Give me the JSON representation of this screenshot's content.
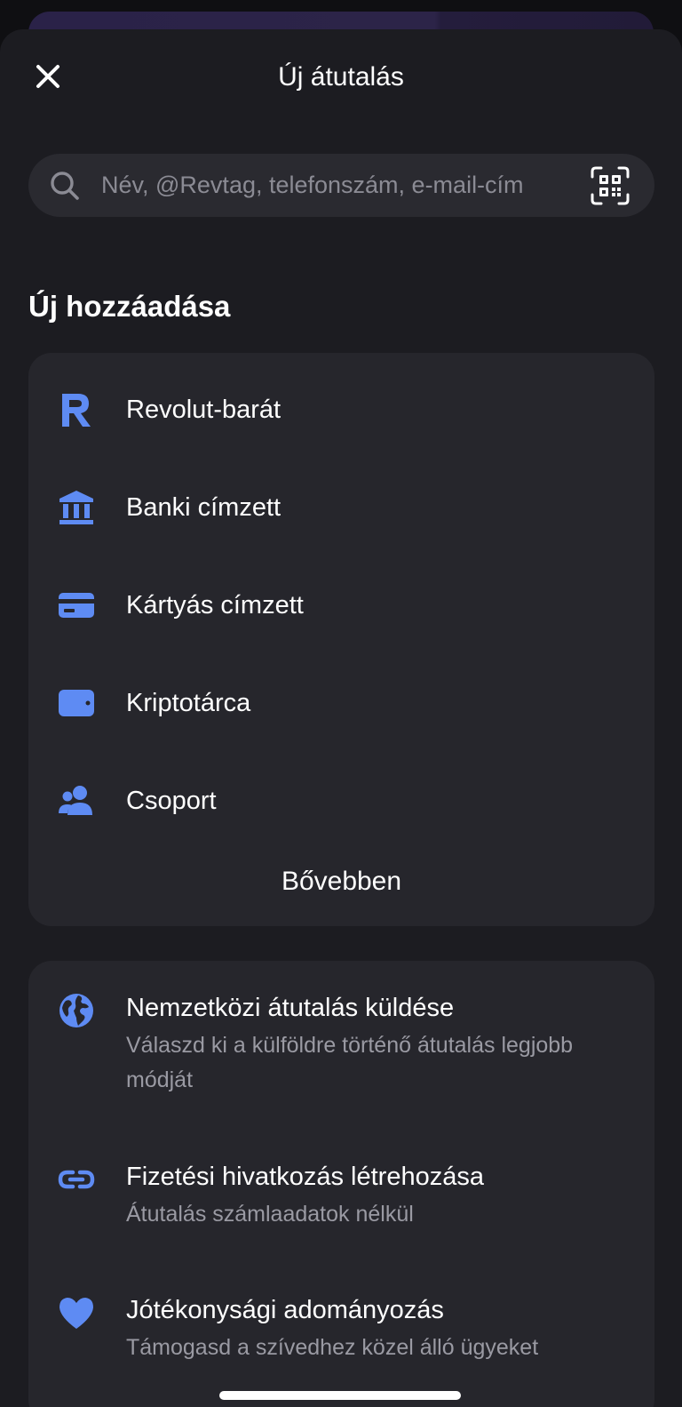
{
  "header": {
    "title": "Új átutalás",
    "close_icon": "close-icon"
  },
  "search": {
    "placeholder": "Név, @Revtag, telefonszám, e-mail-cím",
    "search_icon": "search-icon",
    "scan_icon": "qr-scan-icon"
  },
  "add_new": {
    "title": "Új hozzáadása",
    "items": [
      {
        "label": "Revolut-barát",
        "icon": "revolut-logo-icon"
      },
      {
        "label": "Banki címzett",
        "icon": "bank-icon"
      },
      {
        "label": "Kártyás címzett",
        "icon": "card-icon"
      },
      {
        "label": "Kriptotárca",
        "icon": "wallet-icon"
      },
      {
        "label": "Csoport",
        "icon": "group-icon"
      }
    ],
    "more_label": "Bővebben"
  },
  "options": [
    {
      "label": "Nemzetközi átutalás küldése",
      "subtitle": "Válaszd ki a külföldre történő átutalás legjobb módját",
      "icon": "globe-icon"
    },
    {
      "label": "Fizetési hivatkozás létrehozása",
      "subtitle": "Átutalás számlaadatok nélkül",
      "icon": "link-icon"
    },
    {
      "label": "Jótékonysági adományozás",
      "subtitle": "Támogasd a szívedhez közel álló ügyeket",
      "icon": "heart-icon"
    }
  ],
  "colors": {
    "accent": "#5e8bf3",
    "sheet_background": "#1c1c21",
    "card_background": "#26262c",
    "secondary_text": "#9a9aa3"
  }
}
